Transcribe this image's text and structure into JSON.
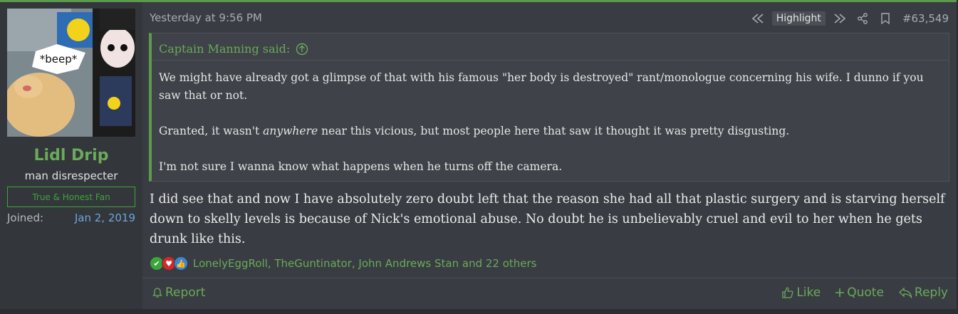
{
  "post": {
    "timestamp": "Yesterday at 9:56 PM",
    "highlight_label": "Highlight",
    "post_number": "#63,549",
    "accent_color": "#5c9a4c"
  },
  "user": {
    "name": "Lidl Drip",
    "title": "man disrespecter",
    "banner": "True & Honest Fan",
    "joined_label": "Joined:",
    "joined_value": "Jan 2, 2019",
    "avatar_caption": "*beep*"
  },
  "quote": {
    "author_line": "Captain Manning said:",
    "p1": "We might have already got a glimpse of that with his famous \"her body is destroyed\" rant/monologue concerning his wife. I dunno if you saw that or not.",
    "p2_before": "Granted, it wasn't ",
    "p2_emph": "anywhere",
    "p2_after": " near this vicious, but most people here that saw it thought it was pretty disgusting.",
    "p3": "I'm not sure I wanna know what happens when he turns off the camera."
  },
  "message": "I did see that and now I have absolutely zero doubt left that the reason she had all that plastic surgery and is starving herself down to skelly levels is because of Nick's emotional abuse. No doubt he is unbelievably cruel and evil to her when he gets drunk like this.",
  "reactions": {
    "icons": [
      "check-reaction-icon",
      "heart-reaction-icon",
      "thumbs-up-reaction-icon"
    ],
    "list": "LonelyEggRoll, TheGuntinator, John Andrews Stan and 22 others"
  },
  "footer": {
    "report": "Report",
    "like": "Like",
    "quote": "Quote",
    "reply": "Reply"
  }
}
